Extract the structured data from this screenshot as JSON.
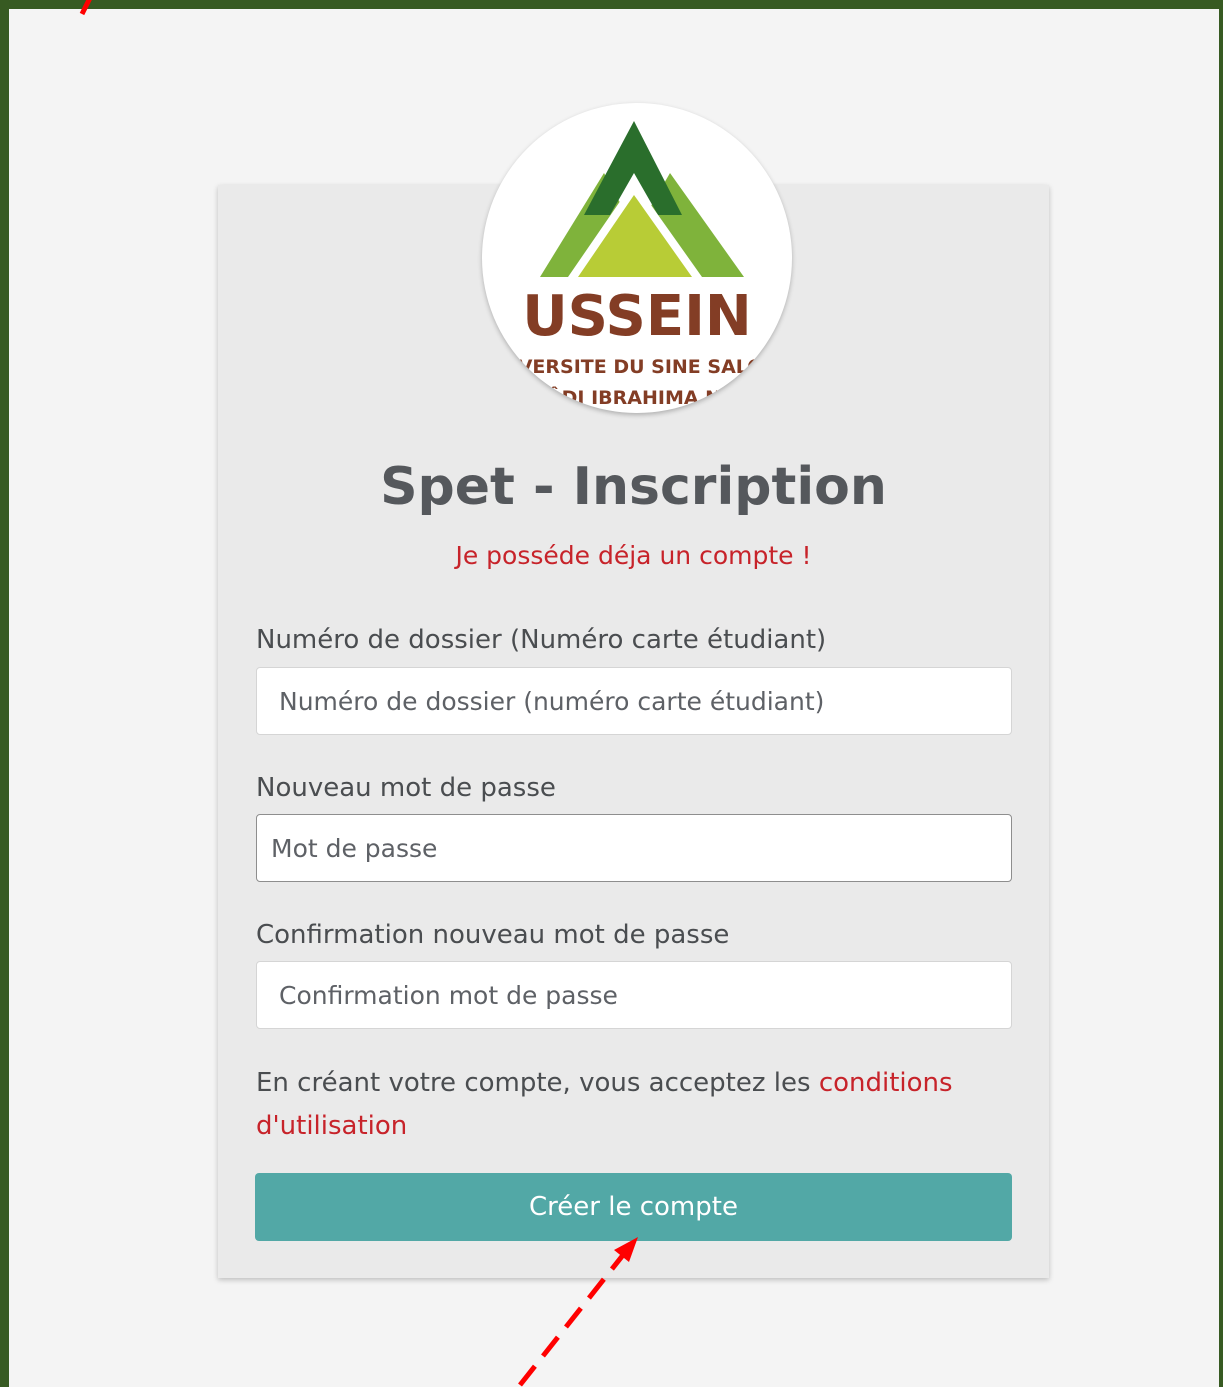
{
  "logo": {
    "name": "USSEIN",
    "line1": "IVERSITE DU SINE SALO",
    "line2": "ÂDJ IBRAHIMA N"
  },
  "page": {
    "title": "Spet - Inscription",
    "login_link": "Je posséde déja un compte !"
  },
  "form": {
    "dossier": {
      "label": "Numéro de dossier (Numéro carte étudiant)",
      "placeholder": "Numéro de dossier (numéro carte étudiant)"
    },
    "password": {
      "label": "Nouveau mot de passe",
      "placeholder": "Mot de passe"
    },
    "confirm": {
      "label": "Confirmation nouveau mot de passe",
      "placeholder": "Confirmation mot de passe"
    },
    "terms_text": "En créant votre compte, vous acceptez les ",
    "terms_link": "conditions d'utilisation",
    "submit_label": "Créer le compte"
  },
  "colors": {
    "frame": "#375a22",
    "accent_red": "#c7232a",
    "button": "#52a8a6",
    "annotation_arrow": "#ff0000"
  }
}
